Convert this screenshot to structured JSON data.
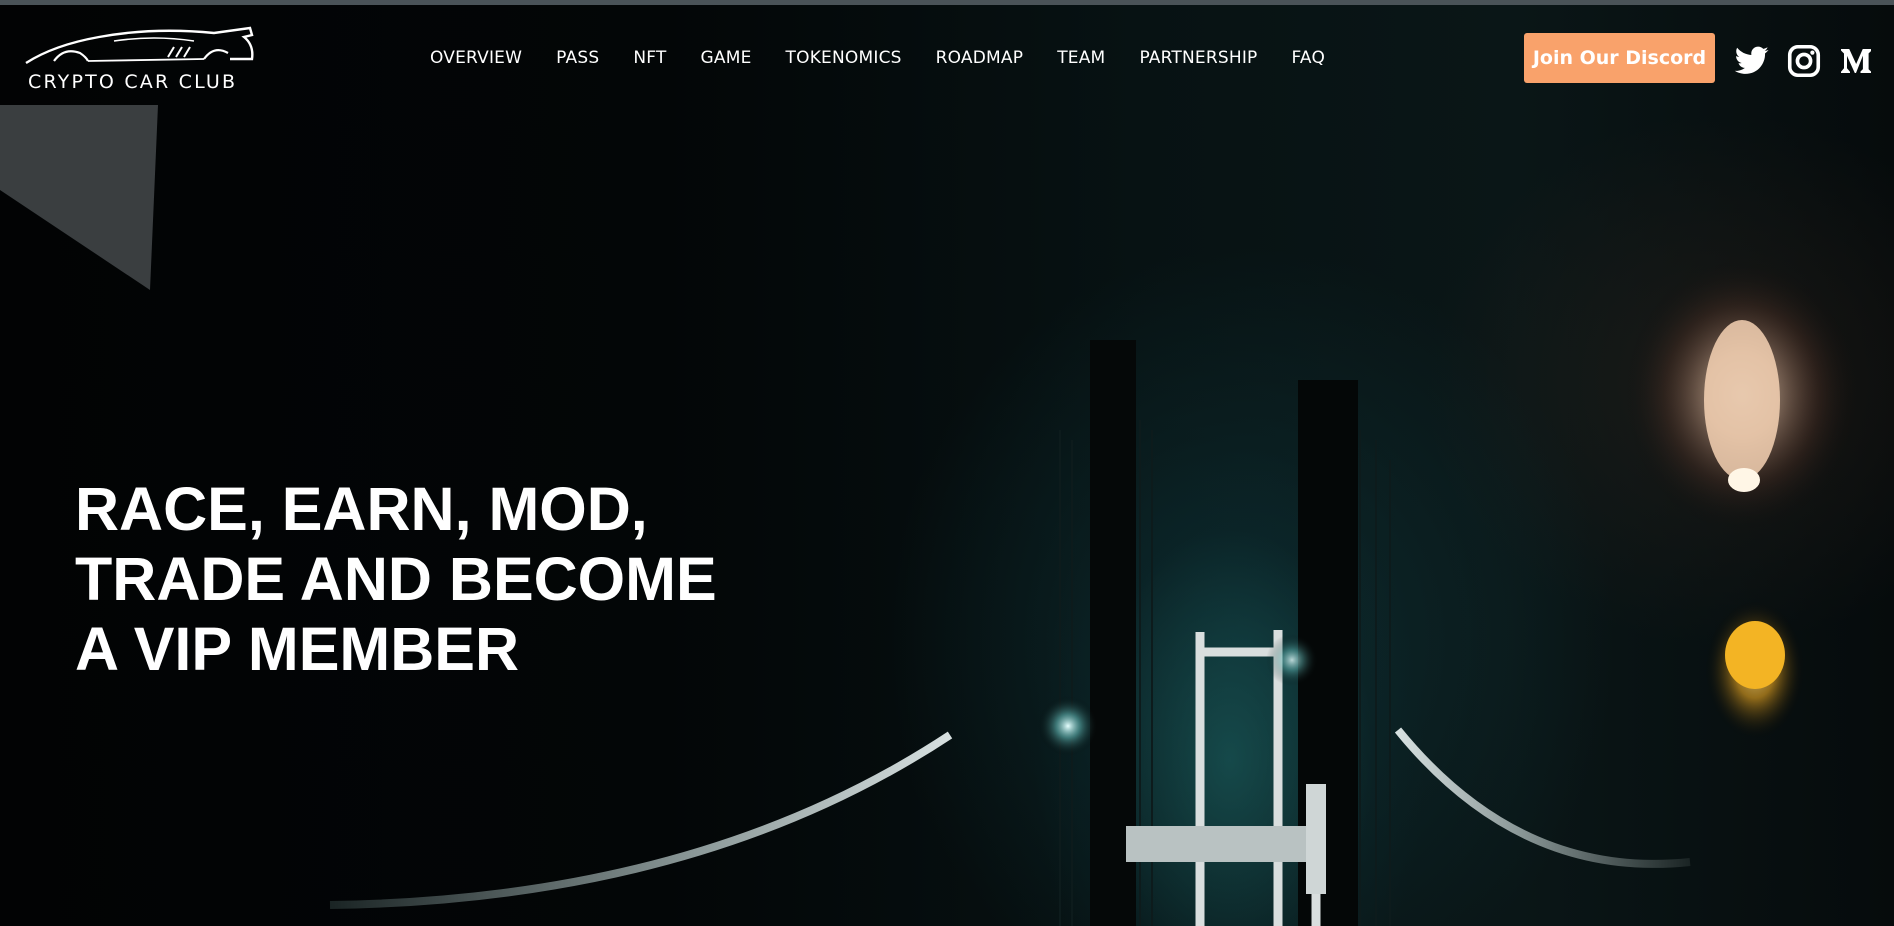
{
  "brand": {
    "logo_text": "CRYPTO CAR CLUB"
  },
  "nav": {
    "links": [
      {
        "label": "OVERVIEW"
      },
      {
        "label": "PASS"
      },
      {
        "label": "NFT"
      },
      {
        "label": "GAME"
      },
      {
        "label": "TOKENOMICS"
      },
      {
        "label": "ROADMAP"
      },
      {
        "label": "TEAM"
      },
      {
        "label": "PARTNERSHIP"
      },
      {
        "label": "FAQ"
      }
    ]
  },
  "cta": {
    "discord_label": "Join Our Discord",
    "color": "#f9a26b"
  },
  "social": {
    "icons": [
      "twitter-icon",
      "instagram-icon",
      "medium-icon"
    ]
  },
  "hero": {
    "headline_lines": [
      "RACE, EARN, MOD,",
      "TRADE AND BECOME",
      "A VIP MEMBER"
    ]
  }
}
